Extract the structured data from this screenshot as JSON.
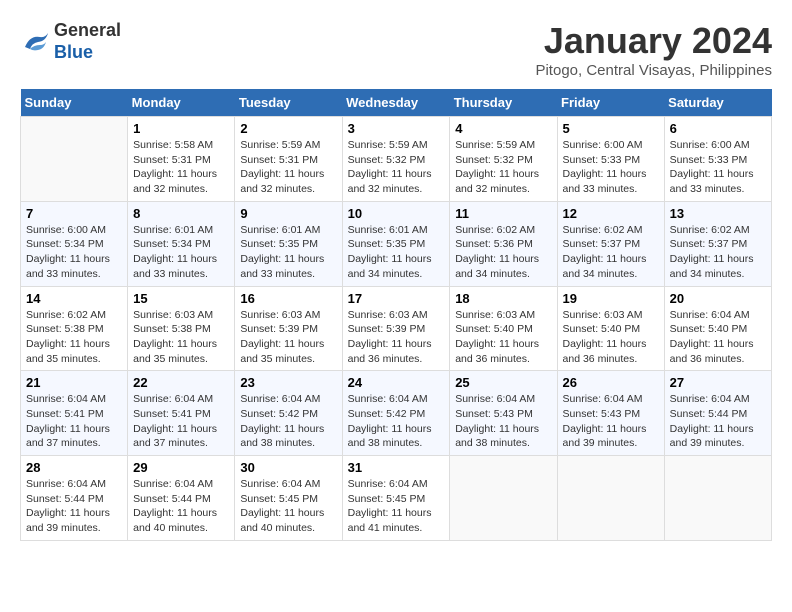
{
  "header": {
    "logo_general": "General",
    "logo_blue": "Blue",
    "month_title": "January 2024",
    "location": "Pitogo, Central Visayas, Philippines"
  },
  "days_of_week": [
    "Sunday",
    "Monday",
    "Tuesday",
    "Wednesday",
    "Thursday",
    "Friday",
    "Saturday"
  ],
  "weeks": [
    [
      {
        "day": "",
        "info": ""
      },
      {
        "day": "1",
        "info": "Sunrise: 5:58 AM\nSunset: 5:31 PM\nDaylight: 11 hours\nand 32 minutes."
      },
      {
        "day": "2",
        "info": "Sunrise: 5:59 AM\nSunset: 5:31 PM\nDaylight: 11 hours\nand 32 minutes."
      },
      {
        "day": "3",
        "info": "Sunrise: 5:59 AM\nSunset: 5:32 PM\nDaylight: 11 hours\nand 32 minutes."
      },
      {
        "day": "4",
        "info": "Sunrise: 5:59 AM\nSunset: 5:32 PM\nDaylight: 11 hours\nand 32 minutes."
      },
      {
        "day": "5",
        "info": "Sunrise: 6:00 AM\nSunset: 5:33 PM\nDaylight: 11 hours\nand 33 minutes."
      },
      {
        "day": "6",
        "info": "Sunrise: 6:00 AM\nSunset: 5:33 PM\nDaylight: 11 hours\nand 33 minutes."
      }
    ],
    [
      {
        "day": "7",
        "info": "Sunrise: 6:00 AM\nSunset: 5:34 PM\nDaylight: 11 hours\nand 33 minutes."
      },
      {
        "day": "8",
        "info": "Sunrise: 6:01 AM\nSunset: 5:34 PM\nDaylight: 11 hours\nand 33 minutes."
      },
      {
        "day": "9",
        "info": "Sunrise: 6:01 AM\nSunset: 5:35 PM\nDaylight: 11 hours\nand 33 minutes."
      },
      {
        "day": "10",
        "info": "Sunrise: 6:01 AM\nSunset: 5:35 PM\nDaylight: 11 hours\nand 34 minutes."
      },
      {
        "day": "11",
        "info": "Sunrise: 6:02 AM\nSunset: 5:36 PM\nDaylight: 11 hours\nand 34 minutes."
      },
      {
        "day": "12",
        "info": "Sunrise: 6:02 AM\nSunset: 5:37 PM\nDaylight: 11 hours\nand 34 minutes."
      },
      {
        "day": "13",
        "info": "Sunrise: 6:02 AM\nSunset: 5:37 PM\nDaylight: 11 hours\nand 34 minutes."
      }
    ],
    [
      {
        "day": "14",
        "info": "Sunrise: 6:02 AM\nSunset: 5:38 PM\nDaylight: 11 hours\nand 35 minutes."
      },
      {
        "day": "15",
        "info": "Sunrise: 6:03 AM\nSunset: 5:38 PM\nDaylight: 11 hours\nand 35 minutes."
      },
      {
        "day": "16",
        "info": "Sunrise: 6:03 AM\nSunset: 5:39 PM\nDaylight: 11 hours\nand 35 minutes."
      },
      {
        "day": "17",
        "info": "Sunrise: 6:03 AM\nSunset: 5:39 PM\nDaylight: 11 hours\nand 36 minutes."
      },
      {
        "day": "18",
        "info": "Sunrise: 6:03 AM\nSunset: 5:40 PM\nDaylight: 11 hours\nand 36 minutes."
      },
      {
        "day": "19",
        "info": "Sunrise: 6:03 AM\nSunset: 5:40 PM\nDaylight: 11 hours\nand 36 minutes."
      },
      {
        "day": "20",
        "info": "Sunrise: 6:04 AM\nSunset: 5:40 PM\nDaylight: 11 hours\nand 36 minutes."
      }
    ],
    [
      {
        "day": "21",
        "info": "Sunrise: 6:04 AM\nSunset: 5:41 PM\nDaylight: 11 hours\nand 37 minutes."
      },
      {
        "day": "22",
        "info": "Sunrise: 6:04 AM\nSunset: 5:41 PM\nDaylight: 11 hours\nand 37 minutes."
      },
      {
        "day": "23",
        "info": "Sunrise: 6:04 AM\nSunset: 5:42 PM\nDaylight: 11 hours\nand 38 minutes."
      },
      {
        "day": "24",
        "info": "Sunrise: 6:04 AM\nSunset: 5:42 PM\nDaylight: 11 hours\nand 38 minutes."
      },
      {
        "day": "25",
        "info": "Sunrise: 6:04 AM\nSunset: 5:43 PM\nDaylight: 11 hours\nand 38 minutes."
      },
      {
        "day": "26",
        "info": "Sunrise: 6:04 AM\nSunset: 5:43 PM\nDaylight: 11 hours\nand 39 minutes."
      },
      {
        "day": "27",
        "info": "Sunrise: 6:04 AM\nSunset: 5:44 PM\nDaylight: 11 hours\nand 39 minutes."
      }
    ],
    [
      {
        "day": "28",
        "info": "Sunrise: 6:04 AM\nSunset: 5:44 PM\nDaylight: 11 hours\nand 39 minutes."
      },
      {
        "day": "29",
        "info": "Sunrise: 6:04 AM\nSunset: 5:44 PM\nDaylight: 11 hours\nand 40 minutes."
      },
      {
        "day": "30",
        "info": "Sunrise: 6:04 AM\nSunset: 5:45 PM\nDaylight: 11 hours\nand 40 minutes."
      },
      {
        "day": "31",
        "info": "Sunrise: 6:04 AM\nSunset: 5:45 PM\nDaylight: 11 hours\nand 41 minutes."
      },
      {
        "day": "",
        "info": ""
      },
      {
        "day": "",
        "info": ""
      },
      {
        "day": "",
        "info": ""
      }
    ]
  ]
}
